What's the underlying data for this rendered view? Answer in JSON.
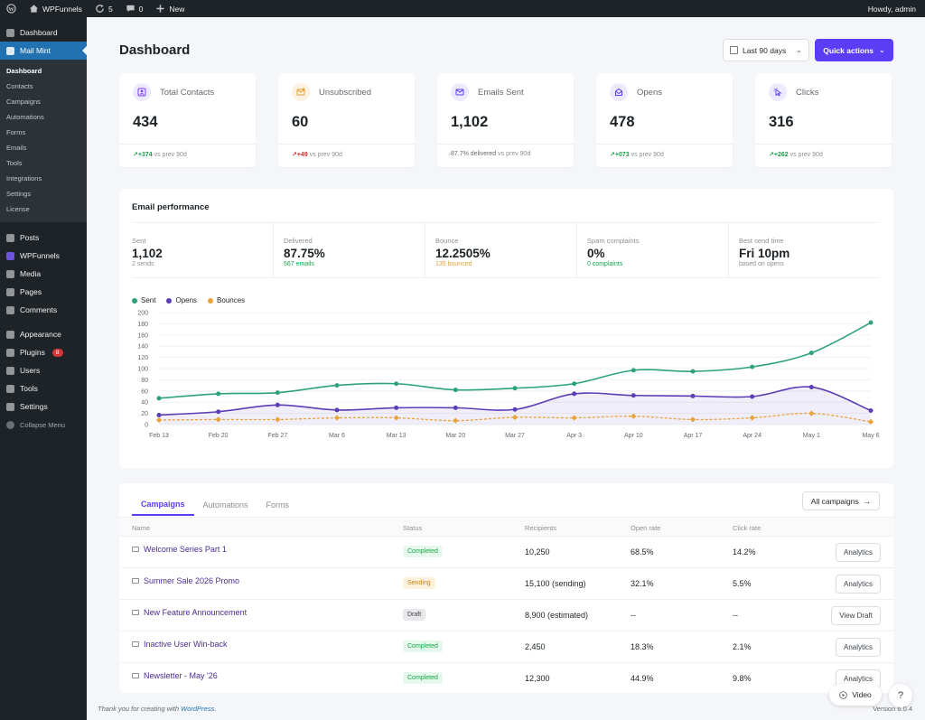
{
  "adminbar": {
    "site_name": "WPFunnels",
    "updates_count": "5",
    "comments_count": "0",
    "new_label": "New",
    "howdy": "Howdy, admin"
  },
  "sidebar": {
    "top_items": [
      {
        "label": "Dashboard",
        "icon": "dashboard-icon"
      }
    ],
    "mail_mint": {
      "label": "Mail Mint",
      "icon": "envelope-icon"
    },
    "submenu": [
      "Dashboard",
      "Contacts",
      "Campaigns",
      "Automations",
      "Forms",
      "Emails",
      "Tools",
      "Integrations",
      "Settings",
      "License"
    ],
    "items": [
      {
        "label": "Posts",
        "icon": "pin-icon"
      },
      {
        "label": "WPFunnels",
        "icon": "funnel-icon"
      },
      {
        "label": "Media",
        "icon": "media-icon"
      },
      {
        "label": "Pages",
        "icon": "pages-icon"
      },
      {
        "label": "Comments",
        "icon": "comments-icon"
      },
      {
        "label": "Appearance",
        "icon": "brush-icon"
      },
      {
        "label": "Plugins",
        "icon": "plug-icon",
        "badge": "8"
      },
      {
        "label": "Users",
        "icon": "users-icon"
      },
      {
        "label": "Tools",
        "icon": "wrench-icon"
      },
      {
        "label": "Settings",
        "icon": "settings-icon"
      }
    ],
    "collapse_label": "Collapse Menu"
  },
  "header": {
    "title": "Dashboard",
    "date_range": "Last 90 days",
    "quick_actions": "Quick actions"
  },
  "stats": [
    {
      "label": "Total Contacts",
      "value": "434",
      "delta": "+374",
      "suffix": " vs prev 90d",
      "trend": "up",
      "icon": "contacts-icon",
      "icon_bg": "#ede9fe",
      "icon_color": "#7c3aed"
    },
    {
      "label": "Unsubscribed",
      "value": "60",
      "delta": "+49",
      "suffix": " vs prev 90d",
      "trend": "down",
      "icon": "unsubscribe-icon",
      "icon_bg": "#fef3e2",
      "icon_color": "#e0a23a"
    },
    {
      "label": "Emails Sent",
      "value": "1,102",
      "delta": "87.7% delivered",
      "suffix": " vs prev 90d",
      "trend": "neutral",
      "icon": "email-icon",
      "icon_bg": "#ede9fe",
      "icon_color": "#5b3df5"
    },
    {
      "label": "Opens",
      "value": "478",
      "delta": "+073",
      "suffix": " vs prev 90d",
      "trend": "up",
      "icon": "opens-icon",
      "icon_bg": "#ede9fe",
      "icon_color": "#5b3df5"
    },
    {
      "label": "Clicks",
      "value": "316",
      "delta": "+262",
      "suffix": " vs prev 90d",
      "trend": "up",
      "icon": "click-icon",
      "icon_bg": "#ede9fe",
      "icon_color": "#5b3df5"
    }
  ],
  "performance": {
    "title": "Email performance",
    "metrics": [
      {
        "label": "Sent",
        "value": "1,102",
        "sub": "2 sends",
        "tone": ""
      },
      {
        "label": "Delivered",
        "value": "87.75%",
        "sub": "567 emails",
        "tone": "green"
      },
      {
        "label": "Bounce",
        "value": "12.2505%",
        "sub": "135 bounced",
        "tone": "orange"
      },
      {
        "label": "Spam complaints",
        "value": "0%",
        "sub": "0 complaints",
        "tone": "green"
      },
      {
        "label": "Best send time",
        "value": "Fri 10pm",
        "sub": "based on opens",
        "tone": ""
      }
    ]
  },
  "chart_data": {
    "type": "line",
    "title": "",
    "xlabel": "",
    "ylabel": "",
    "ylim": [
      0,
      200
    ],
    "yticks": [
      0,
      20,
      40,
      60,
      80,
      100,
      120,
      140,
      160,
      180,
      200
    ],
    "grid": true,
    "legend_position": "top-left",
    "categories": [
      "Feb 13",
      "Feb 20",
      "Feb 27",
      "Mar 6",
      "Mar 13",
      "Mar 20",
      "Mar 27",
      "Apr 3",
      "Apr 10",
      "Apr 17",
      "Apr 24",
      "May 1",
      "May 6"
    ],
    "series": [
      {
        "name": "Sent",
        "color": "#2ea37a",
        "values": [
          47,
          55,
          57,
          70,
          73,
          62,
          65,
          73,
          97,
          95,
          103,
          128,
          182
        ]
      },
      {
        "name": "Opens",
        "color": "#5b3db5",
        "values": [
          17,
          23,
          35,
          26,
          30,
          30,
          27,
          55,
          52,
          51,
          50,
          67,
          25
        ]
      },
      {
        "name": "Bounces",
        "color": "#e8a33d",
        "values": [
          8,
          9,
          9,
          12,
          12,
          7,
          13,
          12,
          15,
          9,
          12,
          20,
          5
        ]
      }
    ]
  },
  "campaigns": {
    "tabs": [
      "Campaigns",
      "Automations",
      "Forms"
    ],
    "all_label": "All campaigns",
    "columns": [
      "Name",
      "Status",
      "Recipients",
      "Open rate",
      "Click rate"
    ],
    "rows": [
      {
        "name": "Welcome Series Part 1",
        "status": "Completed",
        "status_type": "completed",
        "recipients": "10,250",
        "open_rate": "68.5%",
        "click_rate": "14.2%",
        "action": "Analytics"
      },
      {
        "name": "Summer Sale 2026 Promo",
        "status": "Sending",
        "status_type": "sending",
        "recipients": "15,100 (sending)",
        "open_rate": "32.1%",
        "click_rate": "5.5%",
        "action": "Analytics"
      },
      {
        "name": "New Feature Announcement",
        "status": "Draft",
        "status_type": "draft",
        "recipients": "8,900 (estimated)",
        "open_rate": "--",
        "click_rate": "--",
        "action": "View Draft"
      },
      {
        "name": "Inactive User Win-back",
        "status": "Completed",
        "status_type": "completed",
        "recipients": "2,450",
        "open_rate": "18.3%",
        "click_rate": "2.1%",
        "action": "Analytics"
      },
      {
        "name": "Newsletter - May '26",
        "status": "Completed",
        "status_type": "completed",
        "recipients": "12,300",
        "open_rate": "44.9%",
        "click_rate": "9.8%",
        "action": "Analytics"
      }
    ]
  },
  "footer": {
    "thanks_prefix": "Thank you for creating with ",
    "thanks_link": "WordPress",
    "thanks_suffix": ".",
    "version": "Version 6.0.4",
    "video_label": "Video",
    "help_label": "?"
  }
}
